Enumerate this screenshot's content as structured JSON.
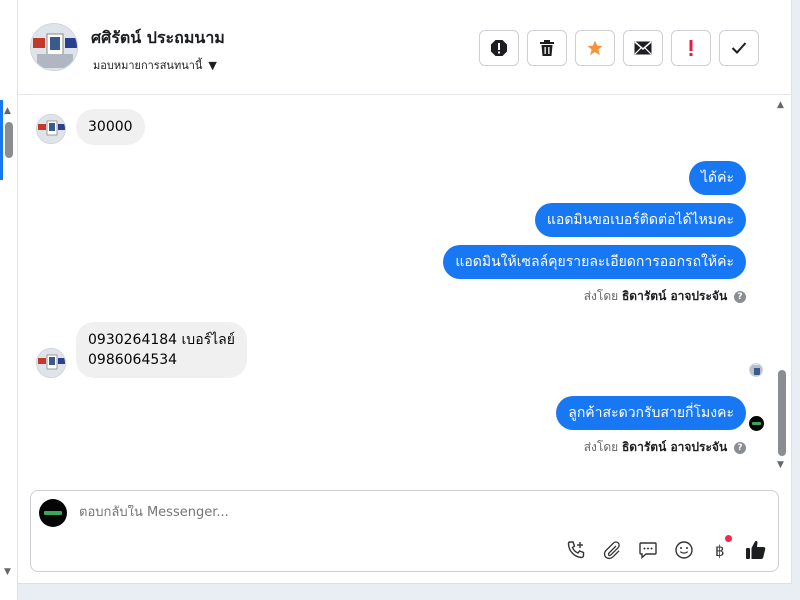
{
  "contact": {
    "name": "ศศิรัตน์ ประถมนาม",
    "assign_label": "มอบหมายการสนทนานี้"
  },
  "toolbar": {
    "buttons": [
      "spam",
      "delete",
      "star",
      "mark-unread",
      "important",
      "done"
    ]
  },
  "colors": {
    "accent": "#1877f2",
    "bubble_in": "#f0f0f0",
    "star": "#f7923a",
    "alert": "#e41e3f"
  },
  "messages": [
    {
      "side": "in",
      "text": "30000"
    },
    {
      "side": "out",
      "text": "ได้ค่ะ"
    },
    {
      "side": "out",
      "text": "แอดมินขอเบอร์ติดต่อได้ไหมคะ"
    },
    {
      "side": "out",
      "text": "แอดมินให้เซลล์คุยรายละเอียดการออกรถให้ค่ะ"
    },
    {
      "side": "meta",
      "prefix": "ส่งโดย",
      "author": "ธิดารัตน์ อาจประจัน"
    },
    {
      "side": "in",
      "line1": "0930264184  เบอร์ไลย์",
      "line2": "0986064534"
    },
    {
      "side": "out",
      "text": "ลูกค้าสะดวกรับสายกี่โมงคะ"
    },
    {
      "side": "meta",
      "prefix": "ส่งโดย",
      "author": "ธิดารัตน์ อาจประจัน"
    }
  ],
  "composer": {
    "placeholder": "ตอบกลับใน Messenger...",
    "tools": [
      "call-icon",
      "attach-icon",
      "saved-replies-icon",
      "emoji-icon",
      "payment-icon",
      "like-icon"
    ]
  }
}
